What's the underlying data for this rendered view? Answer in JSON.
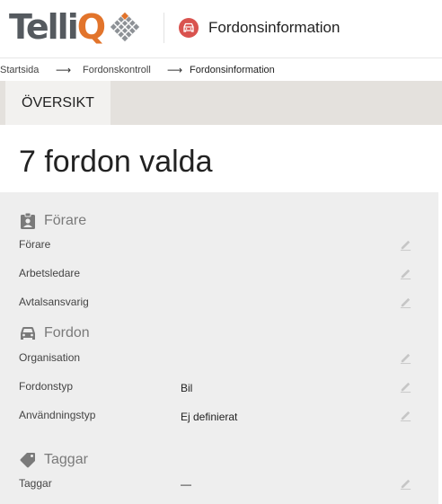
{
  "header": {
    "logo_text_main": "Telli",
    "logo_text_accent": "Q",
    "page_title": "Fordonsinformation",
    "page_icon": "car-icon"
  },
  "breadcrumb": {
    "items": [
      "Startsida",
      "Fordonskontroll",
      "Fordonsinformation"
    ],
    "separator": "⟶"
  },
  "tabs": [
    {
      "label": "ÖVERSIKT"
    }
  ],
  "main": {
    "title": "7 fordon valda"
  },
  "sections": {
    "forare": {
      "heading": "Förare",
      "icon": "badge-icon",
      "rows": [
        {
          "label": "Förare",
          "value": ""
        },
        {
          "label": "Arbetsledare",
          "value": ""
        },
        {
          "label": "Avtalsansvarig",
          "value": ""
        }
      ]
    },
    "fordon": {
      "heading": "Fordon",
      "icon": "car-icon",
      "rows": [
        {
          "label": "Organisation",
          "value": ""
        },
        {
          "label": "Fordonstyp",
          "value": "Bil"
        },
        {
          "label": "Användningstyp",
          "value": "Ej definierat"
        }
      ]
    },
    "taggar": {
      "heading": "Taggar",
      "icon": "tag-icon",
      "rows": [
        {
          "label": "Taggar",
          "value": "—"
        }
      ]
    }
  },
  "colors": {
    "accent": "#e2742b",
    "page_icon_bg": "#d9534f",
    "panel_bg": "#eeeeee",
    "tabbar_bg": "#e4e1dd"
  }
}
